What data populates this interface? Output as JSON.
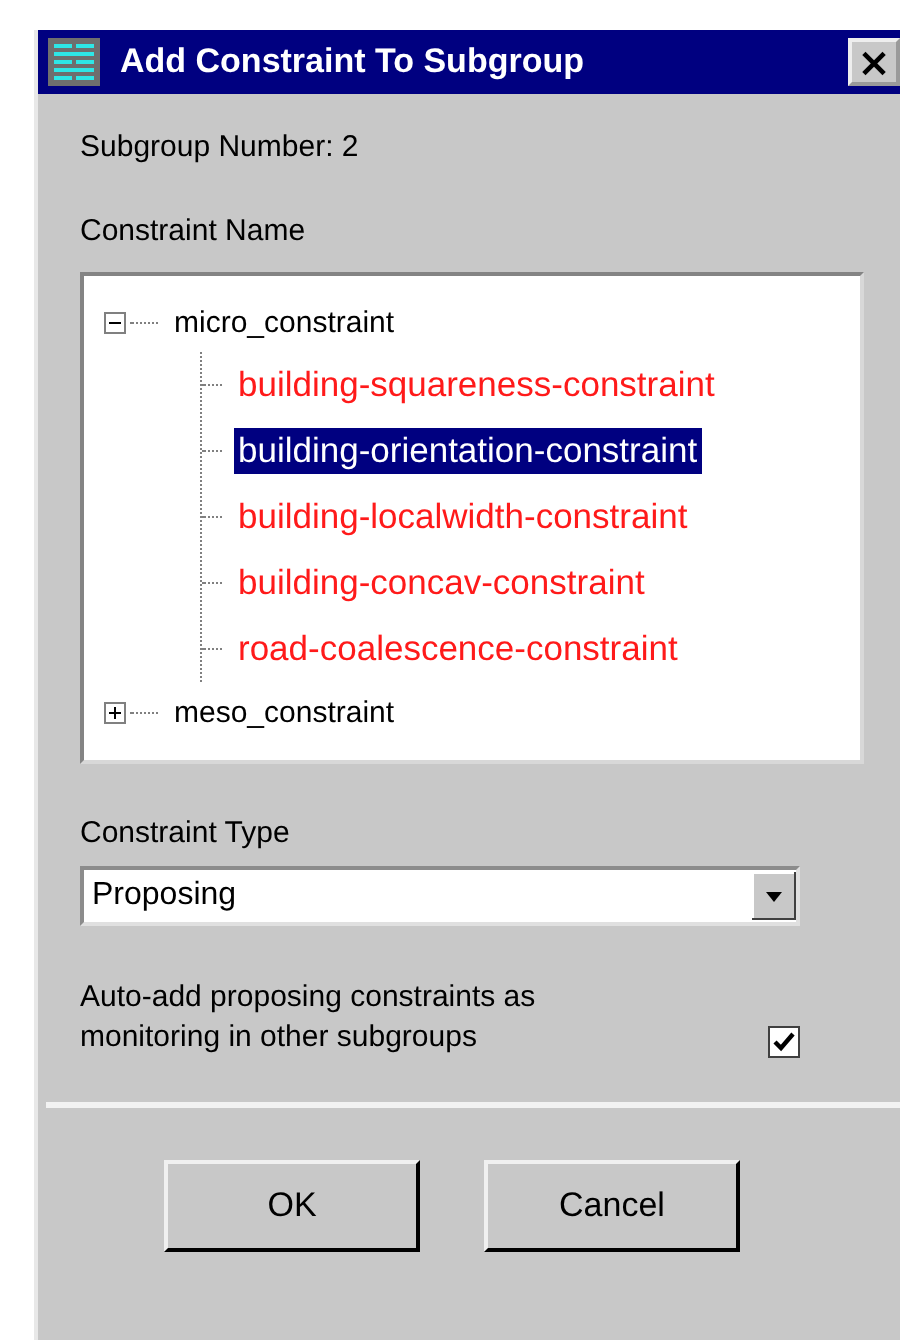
{
  "window": {
    "title": "Add Constraint To Subgroup",
    "close": "×"
  },
  "subgroup_label": "Subgroup Number: 2",
  "constraint_name_label": "Constraint Name",
  "tree": [
    {
      "label": "micro_constraint",
      "expanded": true,
      "selected": false,
      "children": [
        {
          "label": "building-squareness-constraint",
          "selected": false
        },
        {
          "label": "building-orientation-constraint",
          "selected": true
        },
        {
          "label": "building-localwidth-constraint",
          "selected": false
        },
        {
          "label": "building-concav-constraint",
          "selected": false
        },
        {
          "label": "road-coalescence-constraint",
          "selected": false
        }
      ]
    },
    {
      "label": "meso_constraint",
      "expanded": false,
      "selected": false
    }
  ],
  "constraint_type": {
    "label": "Constraint  Type",
    "value": "Proposing"
  },
  "auto_add": {
    "label": "Auto-add proposing constraints as monitoring in other subgroups",
    "checked": true
  },
  "buttons": [
    "OK",
    "Cancel"
  ]
}
